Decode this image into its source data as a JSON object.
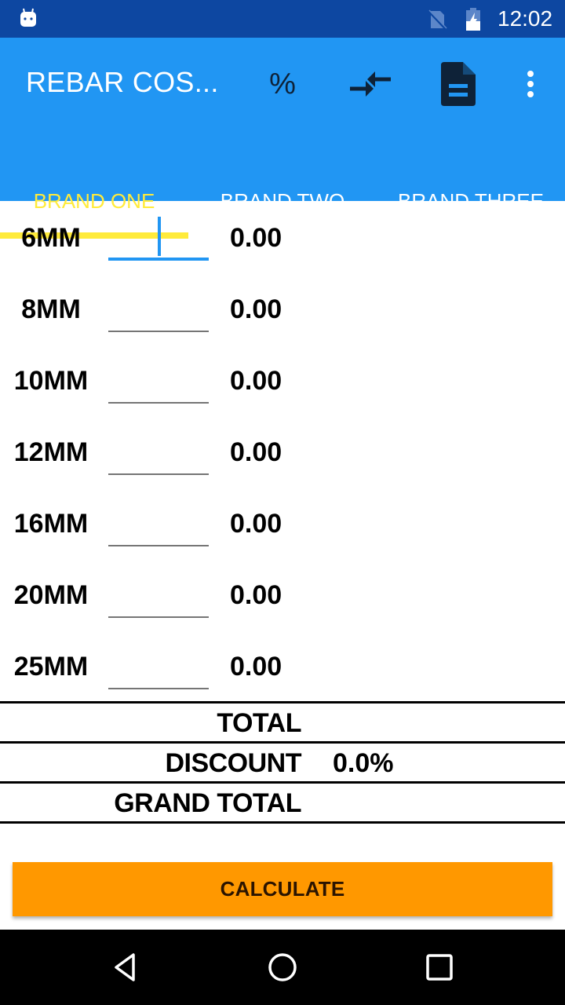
{
  "status_bar": {
    "time": "12:02",
    "icons": [
      "android-notification-icon",
      "no-sim-icon",
      "battery-charging-icon"
    ]
  },
  "app_bar": {
    "title": "REBAR COS...",
    "actions": [
      {
        "name": "discount-percent",
        "label": "%",
        "icon": "percent-icon"
      },
      {
        "name": "compare",
        "icon": "compare-arrows-icon"
      },
      {
        "name": "report",
        "icon": "document-icon"
      },
      {
        "name": "overflow-menu",
        "icon": "more-vert-icon"
      }
    ]
  },
  "tabs": [
    {
      "label": "BRAND ONE",
      "active": true
    },
    {
      "label": "BRAND TWO",
      "active": false
    },
    {
      "label": "BRAND THREE",
      "active": false
    }
  ],
  "rows": [
    {
      "size": "6MM",
      "input_value": "",
      "amount": "0.00",
      "focused": true
    },
    {
      "size": "8MM",
      "input_value": "",
      "amount": "0.00",
      "focused": false
    },
    {
      "size": "10MM",
      "input_value": "",
      "amount": "0.00",
      "focused": false
    },
    {
      "size": "12MM",
      "input_value": "",
      "amount": "0.00",
      "focused": false
    },
    {
      "size": "16MM",
      "input_value": "",
      "amount": "0.00",
      "focused": false
    },
    {
      "size": "20MM",
      "input_value": "",
      "amount": "0.00",
      "focused": false
    },
    {
      "size": "25MM",
      "input_value": "",
      "amount": "0.00",
      "focused": false
    }
  ],
  "summary": {
    "total_label": "TOTAL",
    "total_value": "",
    "discount_label": "DISCOUNT",
    "discount_value": "0.0%",
    "grand_total_label": "GRAND TOTAL",
    "grand_total_value": ""
  },
  "calculate_button": {
    "label": "CALCULATE"
  },
  "colors": {
    "status_bar": "#0D47A1",
    "primary": "#2196F3",
    "tab_indicator": "#FFEB3B",
    "accent_button": "#FF9800"
  }
}
